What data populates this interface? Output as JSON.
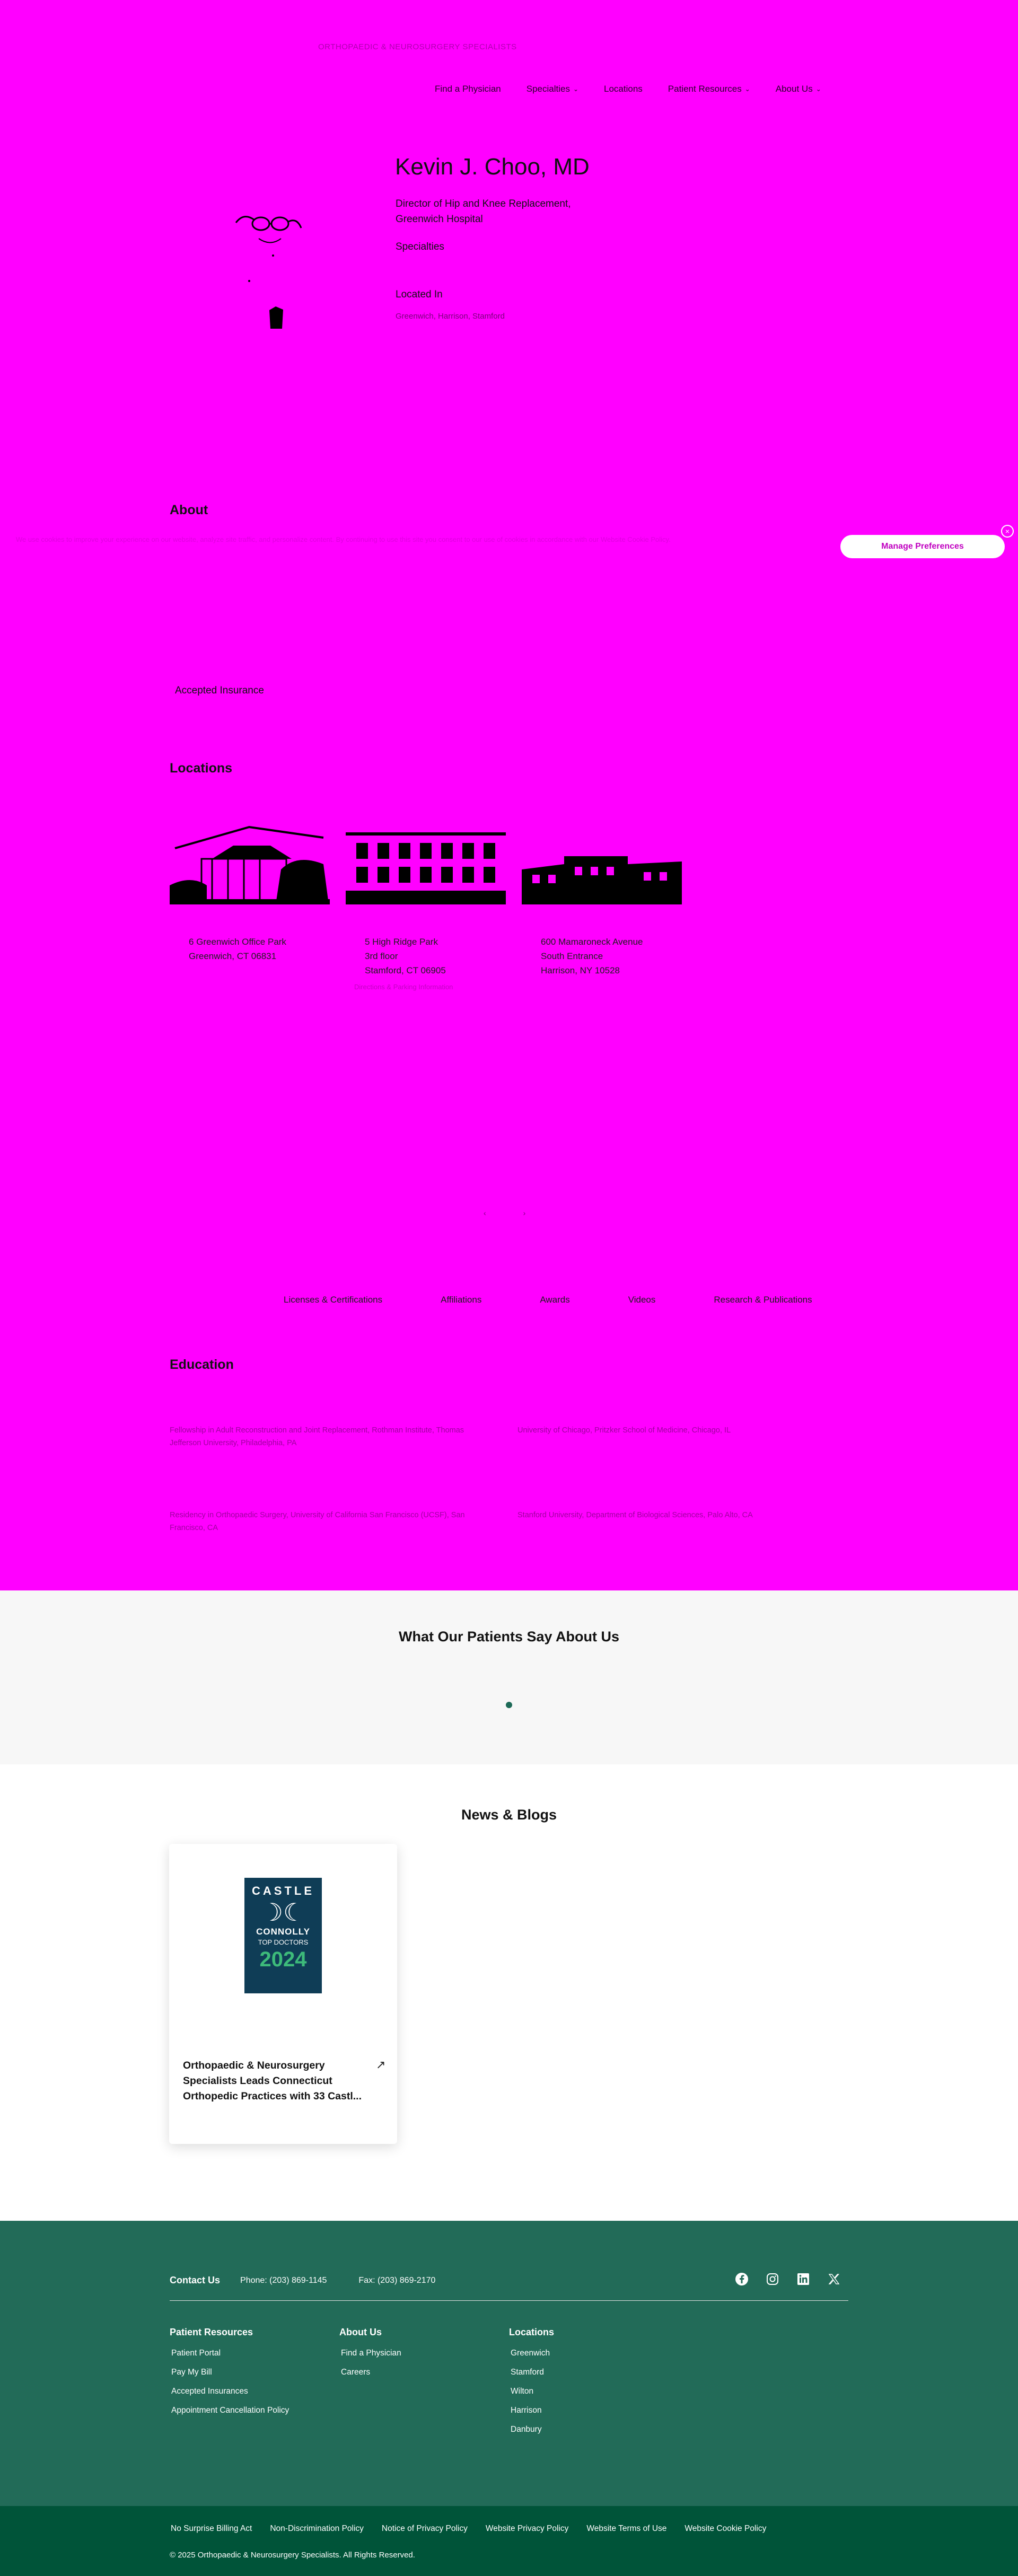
{
  "header": {
    "topbar_text": "ORTHOPAEDIC & NEUROSURGERY SPECIALISTS",
    "nav": [
      {
        "label": "Find a Physician",
        "has_dropdown": false
      },
      {
        "label": "Specialties",
        "has_dropdown": true
      },
      {
        "label": "Locations",
        "has_dropdown": false
      },
      {
        "label": "Patient Resources",
        "has_dropdown": true
      },
      {
        "label": "About Us",
        "has_dropdown": true
      }
    ]
  },
  "hero": {
    "name": "Kevin J. Choo, MD",
    "title": "Director of Hip and Knee Replacement, Greenwich Hospital",
    "specialties_label": "Specialties",
    "located_in_label": "Located In",
    "locations_text": "Greenwich, Harrison, Stamford"
  },
  "about": {
    "heading": "About",
    "cookie_text": "We use cookies to improve your experience on our website, analyze site traffic, and personalize content. By continuing to use this site you consent to our use of cookies in accordance with our Website Cookie Policy.",
    "manage_preferences": "Manage Preferences",
    "close_symbol": "×",
    "accepted_insurance": "Accepted Insurance"
  },
  "locations": {
    "heading": "Locations",
    "cards": [
      {
        "line1": "6 Greenwich Office Park",
        "line2": "Greenwich, CT 06831",
        "line3": "",
        "sub": ""
      },
      {
        "line1": "5 High Ridge Park",
        "line2": "3rd floor",
        "line3": "Stamford, CT 06905",
        "sub": "Directions & Parking Information"
      },
      {
        "line1": "600 Mamaroneck Avenue",
        "line2": "South Entrance",
        "line3": "Harrison, NY 10528",
        "sub": ""
      }
    ],
    "carousel_prev": "‹",
    "carousel_next": "›"
  },
  "tabs": [
    "Licenses & Certifications",
    "Affiliations",
    "Awards",
    "Videos",
    "Research & Publications"
  ],
  "education": {
    "heading": "Education",
    "rows": [
      {
        "left": "Fellowship in Adult Reconstruction and Joint Replacement, Rothman Institute, Thomas Jefferson University, Philadelphia, PA",
        "right": "University of Chicago, Pritzker School of Medicine, Chicago, IL"
      },
      {
        "left": "Residency in Orthopaedic Surgery, University of California San Francisco (UCSF), San Francisco, CA",
        "right": "Stanford University, Department of Biological Sciences, Palo Alto, CA"
      }
    ]
  },
  "testimonials": {
    "heading": "What Our Patients Say About Us"
  },
  "news": {
    "heading": "News & Blogs",
    "card": {
      "badge_line1": "CASTLE",
      "badge_mark": "☽☾",
      "badge_line2": "CONNOLLY",
      "badge_line3": "TOP DOCTORS",
      "badge_year": "2024",
      "title": "Orthopaedic & Neurosurgery Specialists Leads Connecticut Orthopedic Practices with 33 Castl...",
      "arrow": "↗"
    }
  },
  "footer": {
    "contact_label": "Contact Us",
    "phone": "Phone: (203) 869-1145",
    "fax": "Fax: (203) 869-2170",
    "social": [
      "facebook-icon",
      "instagram-icon",
      "linkedin-icon",
      "x-icon"
    ],
    "columns": {
      "patient_resources": {
        "heading": "Patient Resources",
        "links": [
          "Patient Portal",
          "Pay My Bill",
          "Accepted Insurances",
          "Appointment Cancellation Policy"
        ]
      },
      "about_us": {
        "heading": "About Us",
        "links": [
          "Find a Physician",
          "Careers"
        ]
      },
      "locations": {
        "heading": "Locations",
        "links": [
          "Greenwich",
          "Stamford",
          "Wilton",
          "Harrison",
          "Danbury"
        ]
      }
    },
    "bottom_links": [
      "No Surprise Billing Act",
      "Non-Discrimination Policy",
      "Notice of Privacy Policy",
      "Website Privacy Policy",
      "Website Terms of Use",
      "Website Cookie Policy"
    ],
    "copyright": "© 2025 Orthopaedic & Neurosurgery Specialists. All Rights Reserved."
  },
  "colors": {
    "overlay": "#ff00ff",
    "footer": "#226b58",
    "footer_bottom": "#005439",
    "accent": "#1d6a57"
  }
}
